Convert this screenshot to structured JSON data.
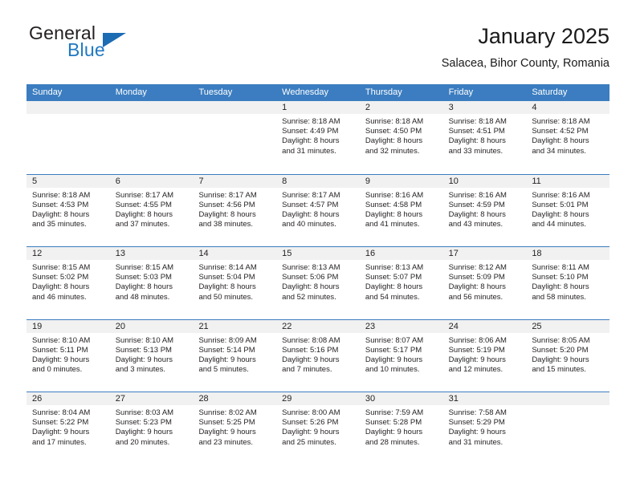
{
  "brand": {
    "word_top": "General",
    "word_bottom": "Blue",
    "flag_icon": "blue-triangle-flag-icon"
  },
  "header": {
    "title": "January 2025",
    "subtitle": "Salacea, Bihor County, Romania"
  },
  "colors": {
    "header_blue": "#3b7dc0",
    "brand_blue": "#2079c2",
    "day_band_gray": "#f1f1f1",
    "text": "#231f20"
  },
  "weekdays": [
    "Sunday",
    "Monday",
    "Tuesday",
    "Wednesday",
    "Thursday",
    "Friday",
    "Saturday"
  ],
  "weeks": [
    [
      {
        "day": "",
        "empty": true
      },
      {
        "day": "",
        "empty": true
      },
      {
        "day": "",
        "empty": true
      },
      {
        "day": "1",
        "sunrise": "Sunrise: 8:18 AM",
        "sunset": "Sunset: 4:49 PM",
        "daylight_1": "Daylight: 8 hours",
        "daylight_2": "and 31 minutes."
      },
      {
        "day": "2",
        "sunrise": "Sunrise: 8:18 AM",
        "sunset": "Sunset: 4:50 PM",
        "daylight_1": "Daylight: 8 hours",
        "daylight_2": "and 32 minutes."
      },
      {
        "day": "3",
        "sunrise": "Sunrise: 8:18 AM",
        "sunset": "Sunset: 4:51 PM",
        "daylight_1": "Daylight: 8 hours",
        "daylight_2": "and 33 minutes."
      },
      {
        "day": "4",
        "sunrise": "Sunrise: 8:18 AM",
        "sunset": "Sunset: 4:52 PM",
        "daylight_1": "Daylight: 8 hours",
        "daylight_2": "and 34 minutes."
      }
    ],
    [
      {
        "day": "5",
        "sunrise": "Sunrise: 8:18 AM",
        "sunset": "Sunset: 4:53 PM",
        "daylight_1": "Daylight: 8 hours",
        "daylight_2": "and 35 minutes."
      },
      {
        "day": "6",
        "sunrise": "Sunrise: 8:17 AM",
        "sunset": "Sunset: 4:55 PM",
        "daylight_1": "Daylight: 8 hours",
        "daylight_2": "and 37 minutes."
      },
      {
        "day": "7",
        "sunrise": "Sunrise: 8:17 AM",
        "sunset": "Sunset: 4:56 PM",
        "daylight_1": "Daylight: 8 hours",
        "daylight_2": "and 38 minutes."
      },
      {
        "day": "8",
        "sunrise": "Sunrise: 8:17 AM",
        "sunset": "Sunset: 4:57 PM",
        "daylight_1": "Daylight: 8 hours",
        "daylight_2": "and 40 minutes."
      },
      {
        "day": "9",
        "sunrise": "Sunrise: 8:16 AM",
        "sunset": "Sunset: 4:58 PM",
        "daylight_1": "Daylight: 8 hours",
        "daylight_2": "and 41 minutes."
      },
      {
        "day": "10",
        "sunrise": "Sunrise: 8:16 AM",
        "sunset": "Sunset: 4:59 PM",
        "daylight_1": "Daylight: 8 hours",
        "daylight_2": "and 43 minutes."
      },
      {
        "day": "11",
        "sunrise": "Sunrise: 8:16 AM",
        "sunset": "Sunset: 5:01 PM",
        "daylight_1": "Daylight: 8 hours",
        "daylight_2": "and 44 minutes."
      }
    ],
    [
      {
        "day": "12",
        "sunrise": "Sunrise: 8:15 AM",
        "sunset": "Sunset: 5:02 PM",
        "daylight_1": "Daylight: 8 hours",
        "daylight_2": "and 46 minutes."
      },
      {
        "day": "13",
        "sunrise": "Sunrise: 8:15 AM",
        "sunset": "Sunset: 5:03 PM",
        "daylight_1": "Daylight: 8 hours",
        "daylight_2": "and 48 minutes."
      },
      {
        "day": "14",
        "sunrise": "Sunrise: 8:14 AM",
        "sunset": "Sunset: 5:04 PM",
        "daylight_1": "Daylight: 8 hours",
        "daylight_2": "and 50 minutes."
      },
      {
        "day": "15",
        "sunrise": "Sunrise: 8:13 AM",
        "sunset": "Sunset: 5:06 PM",
        "daylight_1": "Daylight: 8 hours",
        "daylight_2": "and 52 minutes."
      },
      {
        "day": "16",
        "sunrise": "Sunrise: 8:13 AM",
        "sunset": "Sunset: 5:07 PM",
        "daylight_1": "Daylight: 8 hours",
        "daylight_2": "and 54 minutes."
      },
      {
        "day": "17",
        "sunrise": "Sunrise: 8:12 AM",
        "sunset": "Sunset: 5:09 PM",
        "daylight_1": "Daylight: 8 hours",
        "daylight_2": "and 56 minutes."
      },
      {
        "day": "18",
        "sunrise": "Sunrise: 8:11 AM",
        "sunset": "Sunset: 5:10 PM",
        "daylight_1": "Daylight: 8 hours",
        "daylight_2": "and 58 minutes."
      }
    ],
    [
      {
        "day": "19",
        "sunrise": "Sunrise: 8:10 AM",
        "sunset": "Sunset: 5:11 PM",
        "daylight_1": "Daylight: 9 hours",
        "daylight_2": "and 0 minutes."
      },
      {
        "day": "20",
        "sunrise": "Sunrise: 8:10 AM",
        "sunset": "Sunset: 5:13 PM",
        "daylight_1": "Daylight: 9 hours",
        "daylight_2": "and 3 minutes."
      },
      {
        "day": "21",
        "sunrise": "Sunrise: 8:09 AM",
        "sunset": "Sunset: 5:14 PM",
        "daylight_1": "Daylight: 9 hours",
        "daylight_2": "and 5 minutes."
      },
      {
        "day": "22",
        "sunrise": "Sunrise: 8:08 AM",
        "sunset": "Sunset: 5:16 PM",
        "daylight_1": "Daylight: 9 hours",
        "daylight_2": "and 7 minutes."
      },
      {
        "day": "23",
        "sunrise": "Sunrise: 8:07 AM",
        "sunset": "Sunset: 5:17 PM",
        "daylight_1": "Daylight: 9 hours",
        "daylight_2": "and 10 minutes."
      },
      {
        "day": "24",
        "sunrise": "Sunrise: 8:06 AM",
        "sunset": "Sunset: 5:19 PM",
        "daylight_1": "Daylight: 9 hours",
        "daylight_2": "and 12 minutes."
      },
      {
        "day": "25",
        "sunrise": "Sunrise: 8:05 AM",
        "sunset": "Sunset: 5:20 PM",
        "daylight_1": "Daylight: 9 hours",
        "daylight_2": "and 15 minutes."
      }
    ],
    [
      {
        "day": "26",
        "sunrise": "Sunrise: 8:04 AM",
        "sunset": "Sunset: 5:22 PM",
        "daylight_1": "Daylight: 9 hours",
        "daylight_2": "and 17 minutes."
      },
      {
        "day": "27",
        "sunrise": "Sunrise: 8:03 AM",
        "sunset": "Sunset: 5:23 PM",
        "daylight_1": "Daylight: 9 hours",
        "daylight_2": "and 20 minutes."
      },
      {
        "day": "28",
        "sunrise": "Sunrise: 8:02 AM",
        "sunset": "Sunset: 5:25 PM",
        "daylight_1": "Daylight: 9 hours",
        "daylight_2": "and 23 minutes."
      },
      {
        "day": "29",
        "sunrise": "Sunrise: 8:00 AM",
        "sunset": "Sunset: 5:26 PM",
        "daylight_1": "Daylight: 9 hours",
        "daylight_2": "and 25 minutes."
      },
      {
        "day": "30",
        "sunrise": "Sunrise: 7:59 AM",
        "sunset": "Sunset: 5:28 PM",
        "daylight_1": "Daylight: 9 hours",
        "daylight_2": "and 28 minutes."
      },
      {
        "day": "31",
        "sunrise": "Sunrise: 7:58 AM",
        "sunset": "Sunset: 5:29 PM",
        "daylight_1": "Daylight: 9 hours",
        "daylight_2": "and 31 minutes."
      },
      {
        "day": "",
        "empty": true
      }
    ]
  ]
}
